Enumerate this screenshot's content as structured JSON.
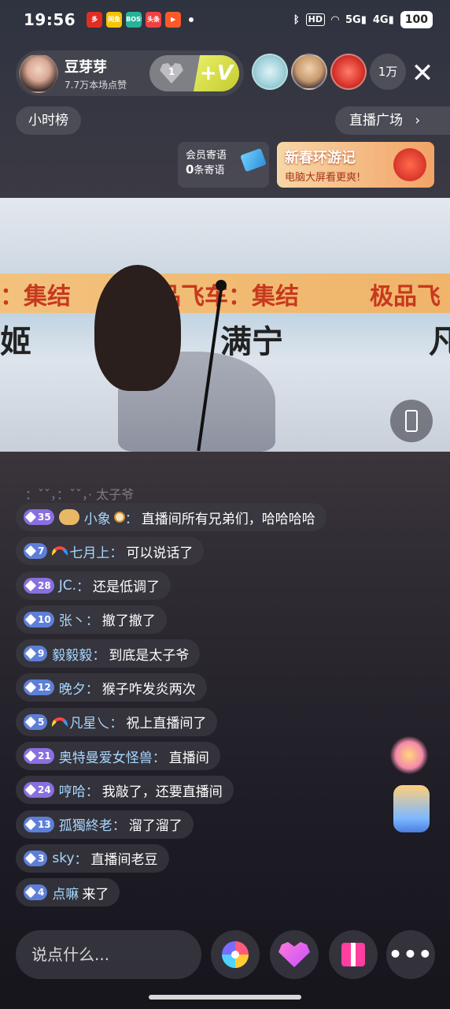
{
  "status_bar": {
    "time": "19:56",
    "apps": [
      {
        "name": "pinduoduo-app-icon",
        "label": "多",
        "color": "#e02e24"
      },
      {
        "name": "xianyu-app-icon",
        "label": "闲鱼",
        "color": "#f5c400"
      },
      {
        "name": "boss-app-icon",
        "label": "BOSS",
        "color": "#27b39a"
      },
      {
        "name": "toutiao-app-icon",
        "label": "头条",
        "color": "#f04142"
      },
      {
        "name": "video-app-icon",
        "label": "▶",
        "color": "#fa5a2a"
      }
    ],
    "hd": "HD",
    "net_5g": "5G",
    "net_4g": "4G",
    "battery": "100"
  },
  "host": {
    "name": "豆芽芽",
    "likes": "7.7万本场点赞",
    "fan_level": "1",
    "vip_label": "+V"
  },
  "viewers": {
    "count": "1万"
  },
  "hourly_rank": "小时榜",
  "plaza": "直播广场",
  "member_msg": {
    "title": "会员寄语",
    "count": "0",
    "suffix": "条寄语"
  },
  "promo": {
    "title": "新春环游记",
    "subtitle": "电脑大屏看更爽!"
  },
  "video": {
    "banner_left": "：集结",
    "banner_mid": "品飞车：集结",
    "banner_right": "极品飞",
    "name_left": "姬",
    "name_mid": "满宁",
    "name_right": "凡"
  },
  "chat": {
    "faded": "：ˇˇ，：ˇˇ，· 太子爷",
    "messages": [
      {
        "level": "35",
        "tier": "purple",
        "fan": true,
        "rainbow": false,
        "food": true,
        "user": "小象",
        "text": "直播间所有兄弟们，哈哈哈哈"
      },
      {
        "level": "7",
        "tier": "blue",
        "fan": false,
        "rainbow": true,
        "food": false,
        "user": "七月上",
        "text": "可以说话了"
      },
      {
        "level": "28",
        "tier": "purple",
        "fan": false,
        "rainbow": false,
        "food": false,
        "user": "JC.",
        "text": "还是低调了"
      },
      {
        "level": "10",
        "tier": "blue",
        "fan": false,
        "rainbow": false,
        "food": false,
        "user": "张丶",
        "text": "撤了撤了"
      },
      {
        "level": "9",
        "tier": "blue",
        "fan": false,
        "rainbow": false,
        "food": false,
        "user": "毅毅毅",
        "text": "到底是太子爷"
      },
      {
        "level": "12",
        "tier": "blue",
        "fan": false,
        "rainbow": false,
        "food": false,
        "user": "晚夕",
        "text": "猴子咋发炎两次"
      },
      {
        "level": "5",
        "tier": "blue",
        "fan": false,
        "rainbow": true,
        "food": false,
        "user": "凡星乀",
        "text": "祝上直播间了"
      },
      {
        "level": "21",
        "tier": "purple",
        "fan": false,
        "rainbow": false,
        "food": false,
        "user": "奥特曼爱女怪兽",
        "text": "直播间"
      },
      {
        "level": "24",
        "tier": "purple",
        "fan": false,
        "rainbow": false,
        "food": false,
        "user": "哼哈",
        "text": "我敲了，还要直播间"
      },
      {
        "level": "13",
        "tier": "blue",
        "fan": false,
        "rainbow": false,
        "food": false,
        "user": "孤獨終老",
        "text": "溜了溜了"
      },
      {
        "level": "3",
        "tier": "blue",
        "fan": false,
        "rainbow": false,
        "food": false,
        "user": "sky",
        "text": "直播间老豆"
      },
      {
        "level": "4",
        "tier": "blue",
        "fan": false,
        "rainbow": false,
        "food": false,
        "user": "点嘛",
        "text": "来了",
        "no_colon": true
      }
    ]
  },
  "bottom": {
    "input_placeholder": "说点什么..."
  }
}
